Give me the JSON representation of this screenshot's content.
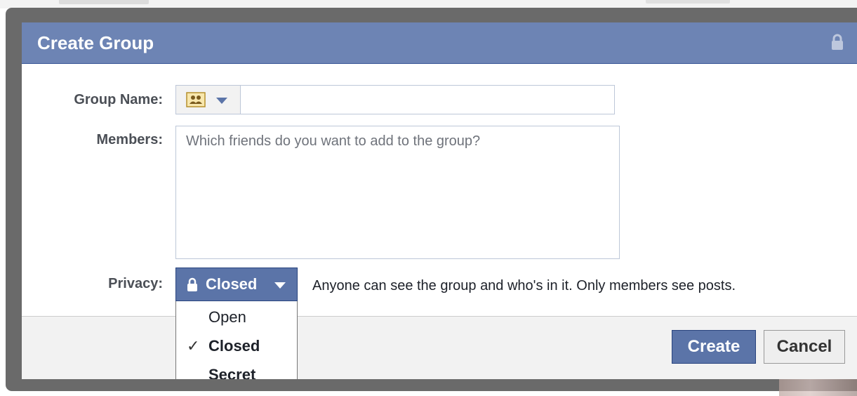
{
  "dialog": {
    "title": "Create Group",
    "accent_color": "#6d84b4",
    "title_icon": "lock-icon"
  },
  "form": {
    "group_name": {
      "label": "Group Name:",
      "value": "",
      "icon": "group-icon",
      "picker_icon": "chevron-down-icon"
    },
    "members": {
      "label": "Members:",
      "placeholder": "Which friends do you want to add to the group?"
    },
    "privacy": {
      "label": "Privacy:",
      "selected": "Closed",
      "icon": "lock-icon",
      "description": "Anyone can see the group and who's in it. Only members see posts.",
      "options": [
        {
          "label": "Open",
          "checked": false
        },
        {
          "label": "Closed",
          "checked": true
        },
        {
          "label": "Secret",
          "checked": false
        }
      ]
    }
  },
  "footer": {
    "create_label": "Create",
    "cancel_label": "Cancel"
  }
}
